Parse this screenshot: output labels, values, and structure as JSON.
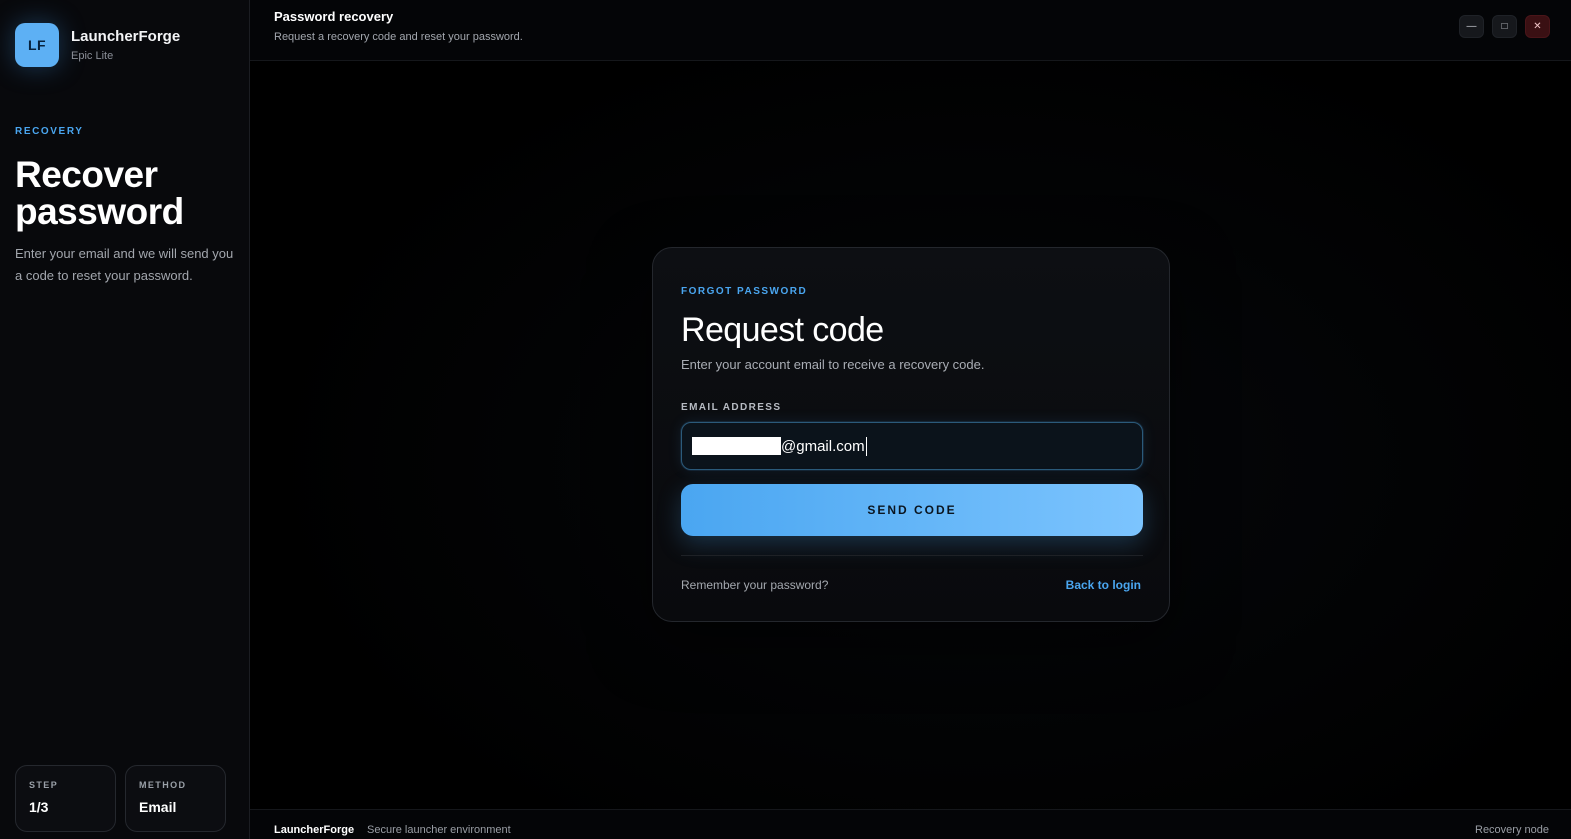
{
  "brand": {
    "logo_text": "LF",
    "name": "LauncherForge",
    "subtitle": "Epic Lite"
  },
  "sidebar": {
    "eyebrow": "RECOVERY",
    "title": "Recover password",
    "description": "Enter your email and we will send you a code to reset your password.",
    "stats": [
      {
        "label": "STEP",
        "value": "1/3"
      },
      {
        "label": "METHOD",
        "value": "Email"
      }
    ]
  },
  "topbar": {
    "title": "Password recovery",
    "subtitle": "Request a recovery code and reset your password.",
    "controls": {
      "minimize": "—",
      "maximize": "□",
      "close": "✕"
    }
  },
  "card": {
    "eyebrow": "FORGOT PASSWORD",
    "title": "Request code",
    "description": "Enter your account email to receive a recovery code.",
    "field_label": "EMAIL ADDRESS",
    "email_value": "@gmail.com",
    "button_label": "SEND CODE",
    "remember_text": "Remember your password?",
    "back_link": "Back to login"
  },
  "footer": {
    "brand": "LauncherForge",
    "description": "Secure launcher environment",
    "right_text": "Recovery node"
  },
  "colors": {
    "accent": "#4aa6f0",
    "background": "#000000",
    "sidebar": "#08090c",
    "close_button": "#3a1013"
  }
}
